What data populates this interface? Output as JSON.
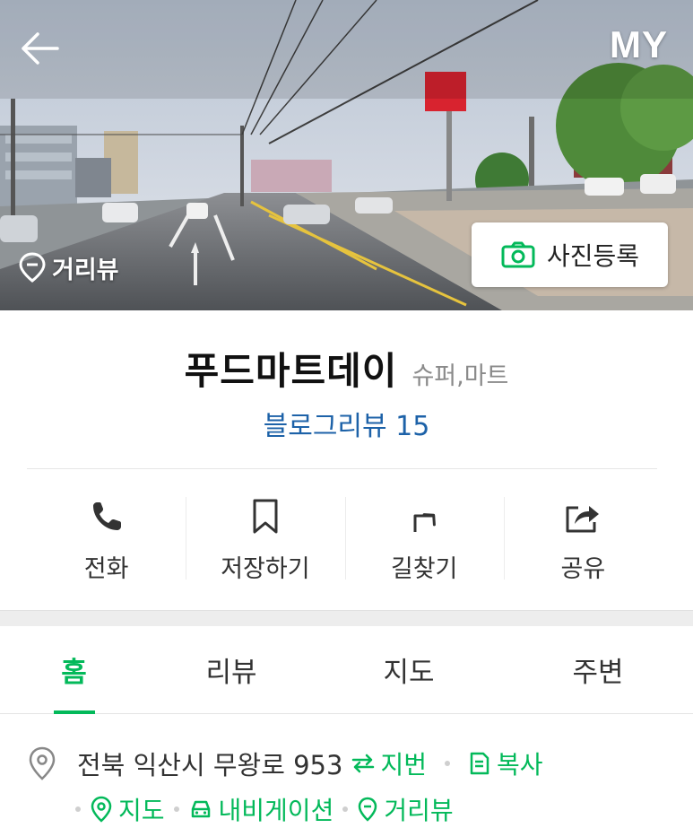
{
  "header": {
    "my_label": "MY",
    "streetview_label": "거리뷰",
    "photo_register_label": "사진등록"
  },
  "place": {
    "name": "푸드마트데이",
    "category": "슈퍼,마트",
    "blog_review_label": "블로그리뷰",
    "blog_review_count": "15"
  },
  "actions": [
    {
      "label": "전화",
      "icon": "phone-icon"
    },
    {
      "label": "저장하기",
      "icon": "bookmark-icon"
    },
    {
      "label": "길찾기",
      "icon": "directions-icon"
    },
    {
      "label": "공유",
      "icon": "share-icon"
    }
  ],
  "tabs": [
    {
      "label": "홈",
      "active": true
    },
    {
      "label": "리뷰",
      "active": false
    },
    {
      "label": "지도",
      "active": false
    },
    {
      "label": "주변",
      "active": false
    }
  ],
  "address": {
    "text": "전북 익산시 무왕로 953",
    "jibun_label": "지번",
    "copy_label": "복사",
    "map_label": "지도",
    "navigation_label": "내비게이션",
    "streetview_label": "거리뷰"
  },
  "colors": {
    "accent_green": "#03b95a",
    "link_blue": "#1d62a8"
  }
}
